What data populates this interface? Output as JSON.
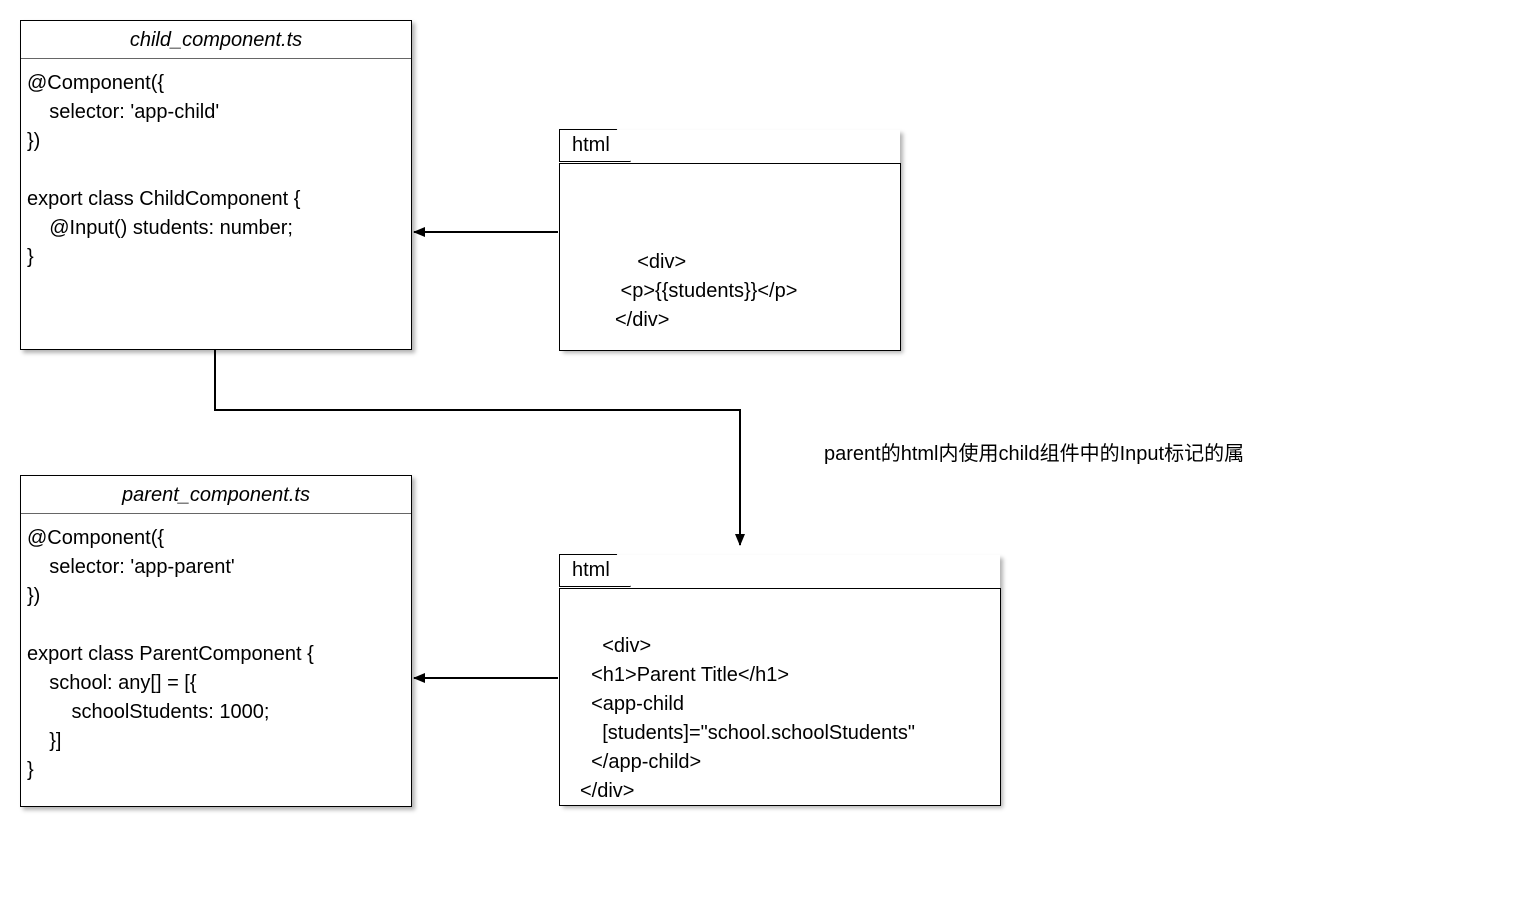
{
  "boxes": {
    "child": {
      "title": "child_component.ts",
      "body": "@Component({\n    selector: 'app-child'\n})\n\nexport class ChildComponent {\n    @Input() students: number;\n}"
    },
    "parent": {
      "title": "parent_component.ts",
      "body": "@Component({\n    selector: 'app-parent'\n})\n\nexport class ParentComponent {\n    school: any[] = [{\n        schoolStudents: 1000;\n    }]\n}"
    }
  },
  "notes": {
    "childHtml": {
      "tab": "html",
      "body": "<div>\n <p>{{students}}</p>\n</div>"
    },
    "parentHtml": {
      "tab": "html",
      "body": "<div>\n  <h1>Parent Title</h1>\n  <app-child\n    [students]=\"school.schoolStudents\"\n  </app-child>\n</div>"
    }
  },
  "edgeLabel": "parent的html内使用child组件中的Input标记的属"
}
